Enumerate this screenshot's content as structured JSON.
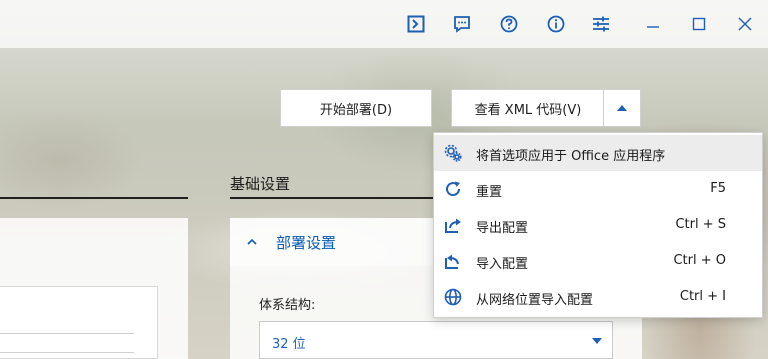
{
  "colors": {
    "accent": "#0b5db5",
    "icon_blue": "#1f5fb6"
  },
  "titlebar": {
    "icons": [
      "terminal-icon",
      "feedback-icon",
      "help-icon",
      "info-icon",
      "settings-sliders-icon"
    ],
    "window_controls": [
      "minimize-icon",
      "maximize-icon",
      "close-icon"
    ]
  },
  "actions": {
    "deploy_label": "开始部署(D)",
    "view_xml_label": "查看 XML 代码(V)"
  },
  "menu": {
    "items": [
      {
        "label": "将首选项应用于 Office 应用程序",
        "shortcut": "",
        "icon": "gear-apply-icon"
      },
      {
        "label": "重置",
        "shortcut": "F5",
        "icon": "refresh-icon"
      },
      {
        "label": "导出配置",
        "shortcut": "Ctrl + S",
        "icon": "export-icon"
      },
      {
        "label": "导入配置",
        "shortcut": "Ctrl + O",
        "icon": "import-icon"
      },
      {
        "label": "从网络位置导入配置",
        "shortcut": "Ctrl + I",
        "icon": "globe-icon"
      }
    ]
  },
  "main": {
    "section_title": "基础设置",
    "panel_title": "部署设置",
    "arch_label": "体系结构:",
    "arch_value": "32 位"
  }
}
